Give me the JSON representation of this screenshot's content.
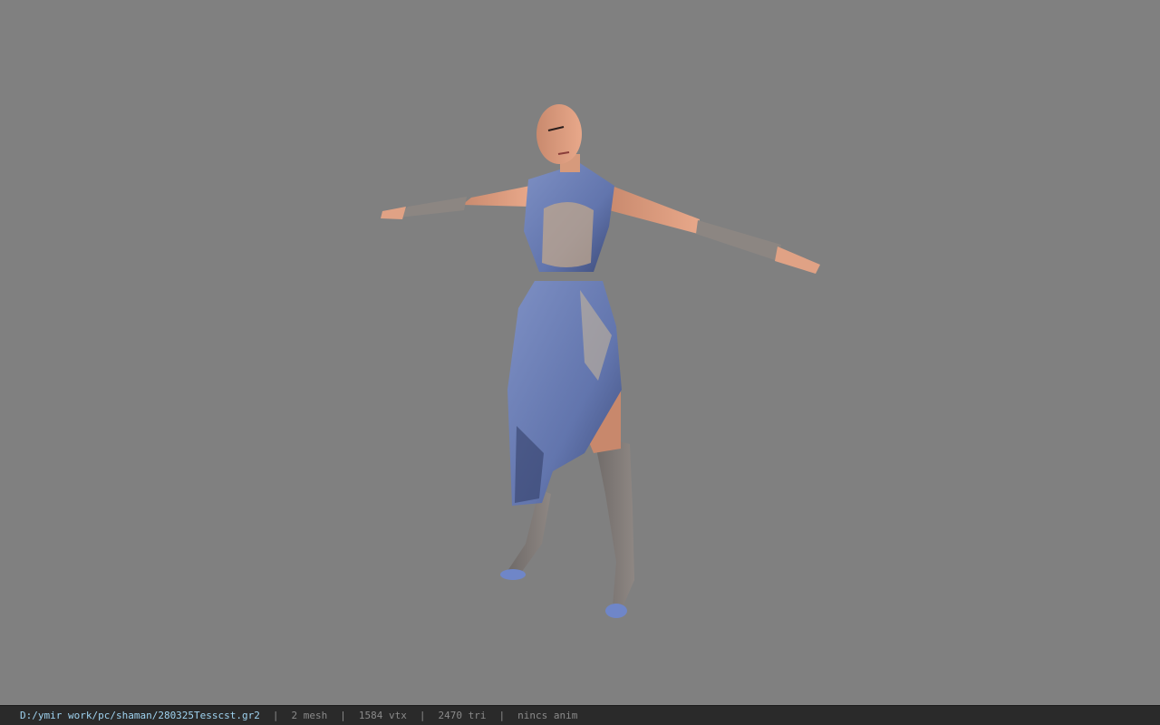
{
  "viewport": {
    "background": "#808080",
    "model": "dress-character-model"
  },
  "status_bar": {
    "file_path": "D:/ymir work/pc/shaman/280325Tesscst.gr2",
    "separator": "|",
    "mesh": "2 mesh",
    "vertices": "1584 vtx",
    "triangles": "2470 tri",
    "animation": "nincs anim",
    "path_color": "#9fd3f0",
    "text_color": "#8a8a8a"
  }
}
